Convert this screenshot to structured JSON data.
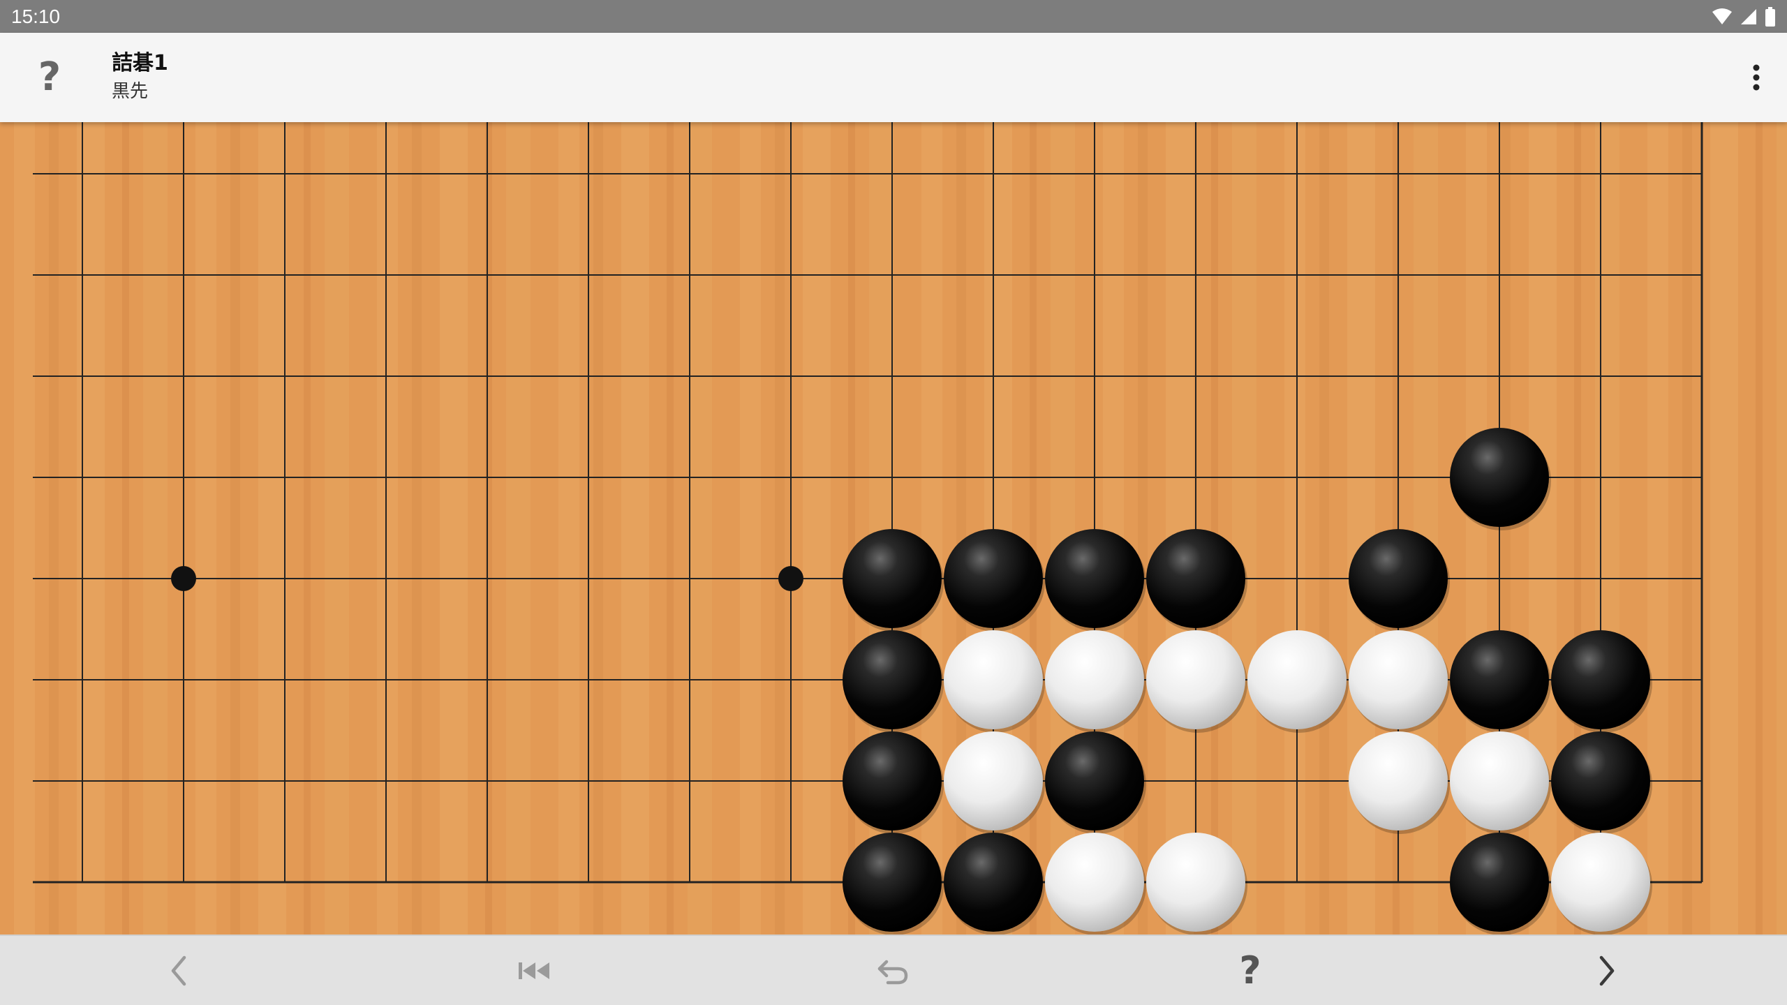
{
  "status_bar": {
    "time": "15:10",
    "icons": [
      "wifi-icon",
      "signal-icon",
      "battery-icon"
    ]
  },
  "app_bar": {
    "help_icon": "?",
    "title": "詰碁1",
    "subtitle": "黒先",
    "menu_icon": "more-vert-icon"
  },
  "board": {
    "board_color": "#e39a55",
    "line_color": "#222222",
    "columns_visible": 17,
    "rows_visible": 8,
    "star_points": [
      [
        1,
        4
      ],
      [
        7,
        4
      ]
    ],
    "stones": [
      {
        "color": "black",
        "col": 14,
        "row": 3
      },
      {
        "color": "black",
        "col": 8,
        "row": 4
      },
      {
        "color": "black",
        "col": 9,
        "row": 4
      },
      {
        "color": "black",
        "col": 10,
        "row": 4
      },
      {
        "color": "black",
        "col": 11,
        "row": 4
      },
      {
        "color": "black",
        "col": 13,
        "row": 4
      },
      {
        "color": "black",
        "col": 8,
        "row": 5
      },
      {
        "color": "white",
        "col": 9,
        "row": 5
      },
      {
        "color": "white",
        "col": 10,
        "row": 5
      },
      {
        "color": "white",
        "col": 11,
        "row": 5
      },
      {
        "color": "white",
        "col": 12,
        "row": 5
      },
      {
        "color": "white",
        "col": 13,
        "row": 5
      },
      {
        "color": "black",
        "col": 14,
        "row": 5
      },
      {
        "color": "black",
        "col": 15,
        "row": 5
      },
      {
        "color": "black",
        "col": 8,
        "row": 6
      },
      {
        "color": "white",
        "col": 9,
        "row": 6
      },
      {
        "color": "black",
        "col": 10,
        "row": 6
      },
      {
        "color": "white",
        "col": 13,
        "row": 6
      },
      {
        "color": "white",
        "col": 14,
        "row": 6
      },
      {
        "color": "black",
        "col": 15,
        "row": 6
      },
      {
        "color": "black",
        "col": 8,
        "row": 7
      },
      {
        "color": "black",
        "col": 9,
        "row": 7
      },
      {
        "color": "white",
        "col": 10,
        "row": 7
      },
      {
        "color": "white",
        "col": 11,
        "row": 7
      },
      {
        "color": "black",
        "col": 14,
        "row": 7
      },
      {
        "color": "white",
        "col": 15,
        "row": 7
      }
    ]
  },
  "bottom_bar": {
    "buttons": [
      {
        "name": "previous-button",
        "icon": "chevron-left-icon"
      },
      {
        "name": "first-move-button",
        "icon": "skip-previous-icon"
      },
      {
        "name": "undo-button",
        "icon": "undo-icon"
      },
      {
        "name": "hint-button",
        "icon": "?"
      },
      {
        "name": "next-button",
        "icon": "chevron-right-icon"
      }
    ]
  }
}
